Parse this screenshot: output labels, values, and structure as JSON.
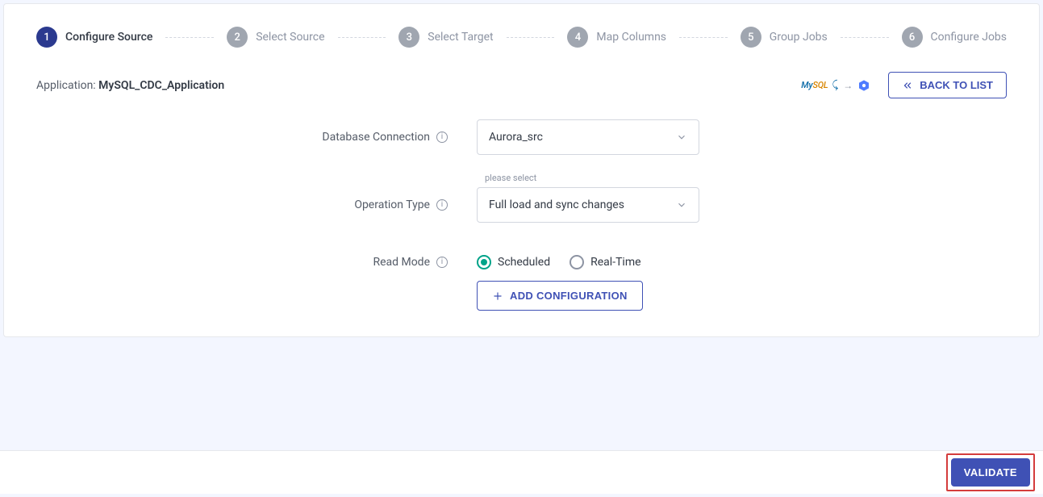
{
  "steps": [
    {
      "num": "1",
      "label": "Configure Source",
      "active": true
    },
    {
      "num": "2",
      "label": "Select Source",
      "active": false
    },
    {
      "num": "3",
      "label": "Select Target",
      "active": false
    },
    {
      "num": "4",
      "label": "Map Columns",
      "active": false
    },
    {
      "num": "5",
      "label": "Group Jobs",
      "active": false
    },
    {
      "num": "6",
      "label": "Configure Jobs",
      "active": false
    }
  ],
  "app": {
    "prefix": "Application: ",
    "name": "MySQL_CDC_Application"
  },
  "back_button": "BACK TO LIST",
  "pipeline": {
    "source_label_my": "My",
    "source_label_sql": "SQL"
  },
  "form": {
    "db_conn_label": "Database Connection",
    "db_conn_value": "Aurora_src",
    "op_type_label": "Operation Type",
    "op_type_hint": "please select",
    "op_type_value": "Full load and sync changes",
    "read_mode_label": "Read Mode",
    "read_mode_options": {
      "scheduled": "Scheduled",
      "realtime": "Real-Time"
    },
    "read_mode_selected": "scheduled",
    "add_config": "ADD CONFIGURATION"
  },
  "footer": {
    "validate": "VALIDATE"
  }
}
